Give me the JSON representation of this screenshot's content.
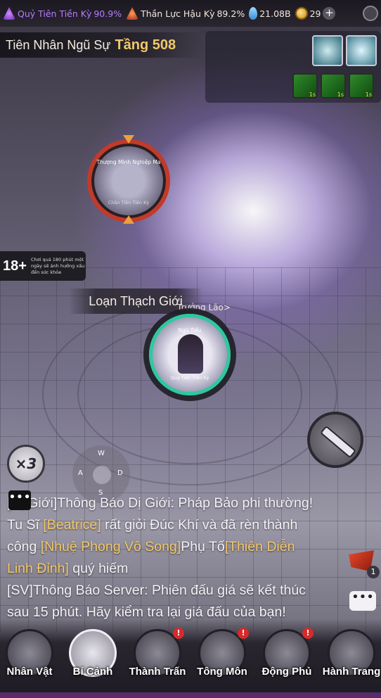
{
  "topbar": {
    "stat1_label": "Quỷ Tiên Tiền Kỳ",
    "stat1_value": "90.9%",
    "stat2_label": "Thần Lực Hậu Kỳ",
    "stat2_value": "89.2%",
    "stat3_value": "21.08B",
    "coins": "29",
    "plus": "+"
  },
  "location": {
    "name": "Tiên Nhân Ngũ Sự",
    "floor": "Tầng 508"
  },
  "enemy": {
    "name": "Thượng Minh Nghiệp Ma",
    "rank": "Chân Tiên Tiền Kỳ"
  },
  "player": {
    "name": "Ngũ Tiểu",
    "rank": "Quỷ Tiên Tiền Kỳ"
  },
  "zone": {
    "name": "Loạn Thạch Giới",
    "sub": "Trưởng Lão>"
  },
  "age_notice": {
    "rating": "18+",
    "text": "Chơi quá 180 phút một ngày sẽ ảnh hưởng xấu đến sức khỏe"
  },
  "controls": {
    "speed": "×3",
    "joy_w": "W",
    "joy_a": "A",
    "joy_d": "D",
    "joy_s": "S"
  },
  "chat": {
    "icon": "•••",
    "l1_a": "[Dị Giới]Thông Báo Dị Giới: Pháp Bảo phi thường!",
    "l2_a": "Tu Sĩ ",
    "l2_b": "[Beatrice]",
    "l2_c": " rất giỏi Đúc Khí và đã rèn thành",
    "l3_a": "công ",
    "l3_b": "[Nhuệ Phong Vô Song]",
    "l3_c": "Phụ Tố",
    "l3_d": "[Thiên Diễn",
    "l4_a": "Linh Đỉnh]",
    "l4_b": " quý hiếm",
    "l5_a": "[SV]Thông Báo Server: Phiên đấu giá sẽ kết thúc",
    "l6_a": "sau 15 phút. Hãy kiểm tra lại giá đấu của bạn!",
    "flag_count": "1",
    "side_chat": "•••"
  },
  "nav": [
    {
      "label": "Nhân Vật",
      "badge": ""
    },
    {
      "label": "Bí Cảnh",
      "badge": ""
    },
    {
      "label": "Thành Trấn",
      "badge": "!"
    },
    {
      "label": "Tông Môn",
      "badge": "!"
    },
    {
      "label": "Động Phủ",
      "badge": "!"
    },
    {
      "label": "Hành Trang",
      "badge": ""
    }
  ],
  "icons": [
    "purple-realm-icon",
    "red-power-icon",
    "drop-icon",
    "coin-icon",
    "plus-icon",
    "clock-icon",
    "sword-icon"
  ]
}
